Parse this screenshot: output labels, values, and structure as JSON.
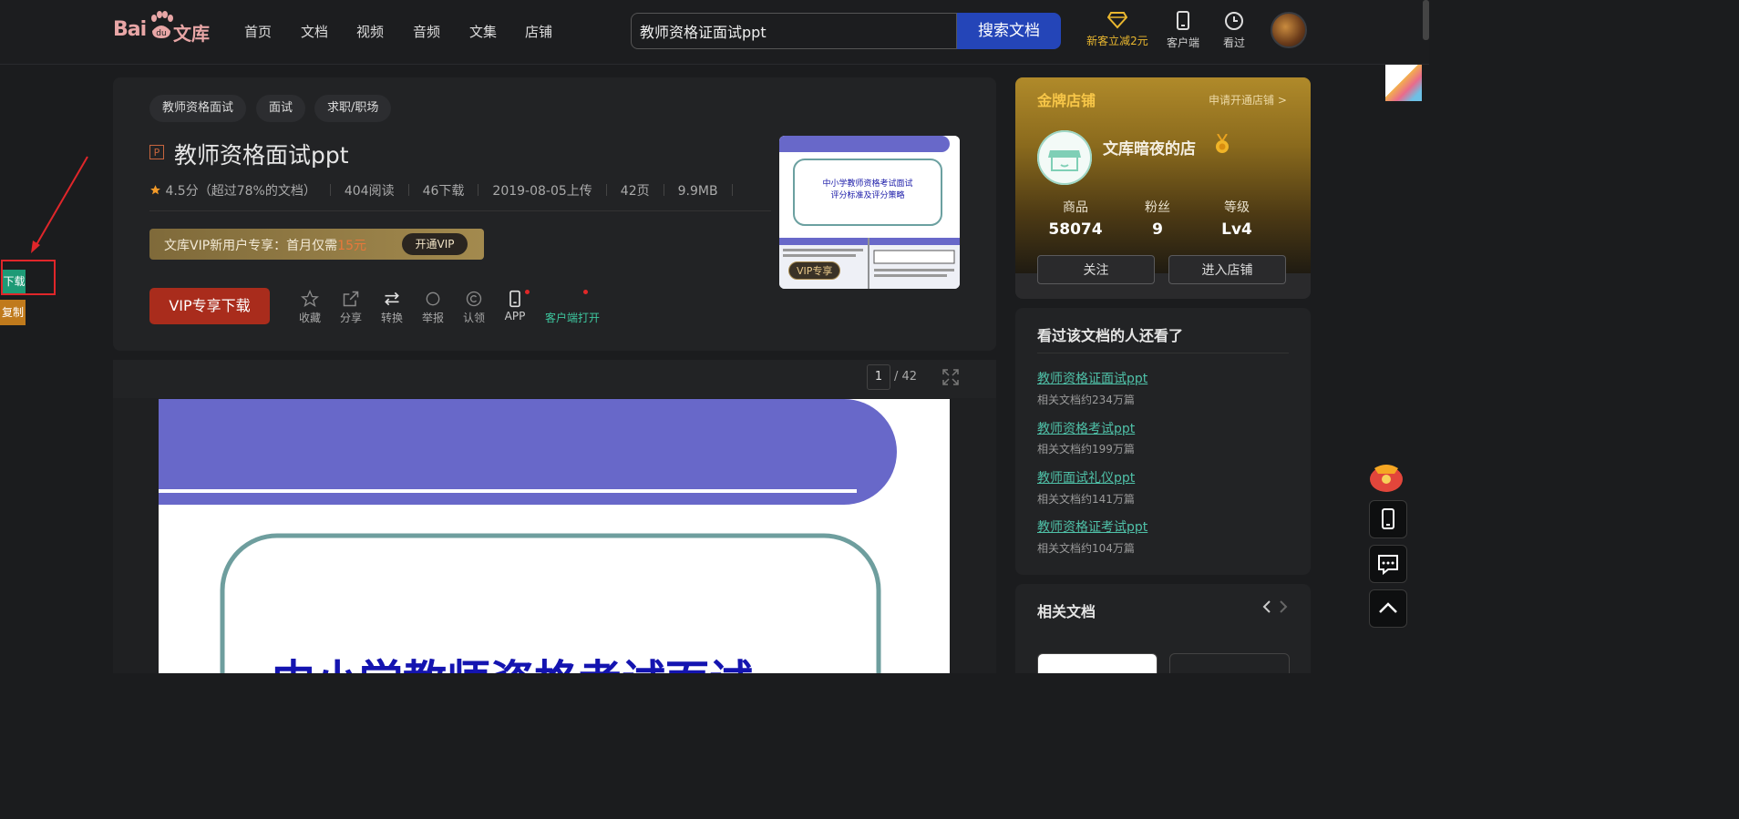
{
  "header": {
    "logo_text_bai": "Bai",
    "logo_text_du": "du",
    "logo_text_wenku": "文库",
    "nav": [
      "首页",
      "文档",
      "视频",
      "音频",
      "文集",
      "店铺"
    ],
    "search_value": "教师资格证面试ppt",
    "search_button": "搜索文档",
    "promo_label": "新客立减2元",
    "client_label": "客户端",
    "history_label": "看过"
  },
  "doc": {
    "tags": [
      "教师资格面试",
      "面试",
      "求职/职场"
    ],
    "type_badge": "P",
    "title": "教师资格面试ppt",
    "rating": "4.5分（超过78%的文档）",
    "reads": "404阅读",
    "downloads": "46下载",
    "upload_date": "2019-08-05上传",
    "pages": "42页",
    "size": "9.9MB",
    "vip_banner_text": "文库VIP新用户专享：首月仅需",
    "vip_banner_price": "15元",
    "vip_open": "开通VIP",
    "download_button": "VIP专享下载",
    "actions": [
      "收藏",
      "分享",
      "转换",
      "举报",
      "认领",
      "APP"
    ],
    "client_open": "客户端打开",
    "thumb_title": "中小学教师资格考试面试评分标准及评分策略",
    "thumb_badge": "VIP专享"
  },
  "viewer": {
    "current_page": "1",
    "total_pages": "/ 42",
    "slide_title": "中小学教师资格考试面试"
  },
  "shop": {
    "label": "金牌店铺",
    "apply": "申请开通店铺 >",
    "name": "文库暗夜的店",
    "stats": [
      {
        "label": "商品",
        "value": "58074"
      },
      {
        "label": "粉丝",
        "value": "9"
      },
      {
        "label": "等级",
        "value": "Lv4"
      }
    ],
    "follow": "关注",
    "enter": "进入店铺"
  },
  "related": {
    "title": "看过该文档的人还看了",
    "items": [
      {
        "title": "教师资格证面试ppt",
        "sub": "相关文档约234万篇"
      },
      {
        "title": "教师资格考试ppt",
        "sub": "相关文档约199万篇"
      },
      {
        "title": "教师面试礼仪ppt",
        "sub": "相关文档约141万篇"
      },
      {
        "title": "教师资格证考试ppt",
        "sub": "相关文档约104万篇"
      }
    ]
  },
  "related_docs": {
    "title": "相关文档"
  },
  "left_tools": {
    "download": "下载",
    "copy": "复制"
  },
  "colors": {
    "accent_blue": "#2445b8",
    "vip_red": "#a92c1c",
    "link_green": "#4fc1a8",
    "slide_purple": "#6868c9"
  }
}
